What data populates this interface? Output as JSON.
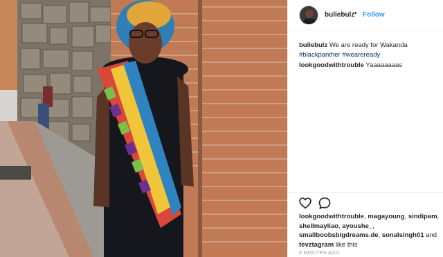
{
  "post": {
    "username": "buliebulz",
    "separator": "•",
    "follow_label": "Follow"
  },
  "caption": {
    "username": "buliebulz",
    "text": "We are ready for Wakanda",
    "hashtags": [
      "#blackpanther",
      "#weareready"
    ]
  },
  "comments": [
    {
      "username": "lookgoodwithtrouble",
      "text": "Yaaaaaaaas"
    }
  ],
  "actions": {
    "like_icon": "heart-icon",
    "comment_icon": "comment-bubble-icon"
  },
  "likes": {
    "users": [
      "lookgoodwithtrouble",
      "magayoung",
      "sindipam",
      "shellmayliao",
      "ayoushe_",
      "smallboobsbigdreams.de",
      "sonalsingh01",
      "tevztagram"
    ],
    "and_word": "and",
    "suffix": "like this"
  },
  "timestamp": "9 MINUTES AGO",
  "colors": {
    "link": "#3897f0",
    "hashtag": "#003569",
    "text": "#262626",
    "muted": "#999999"
  }
}
